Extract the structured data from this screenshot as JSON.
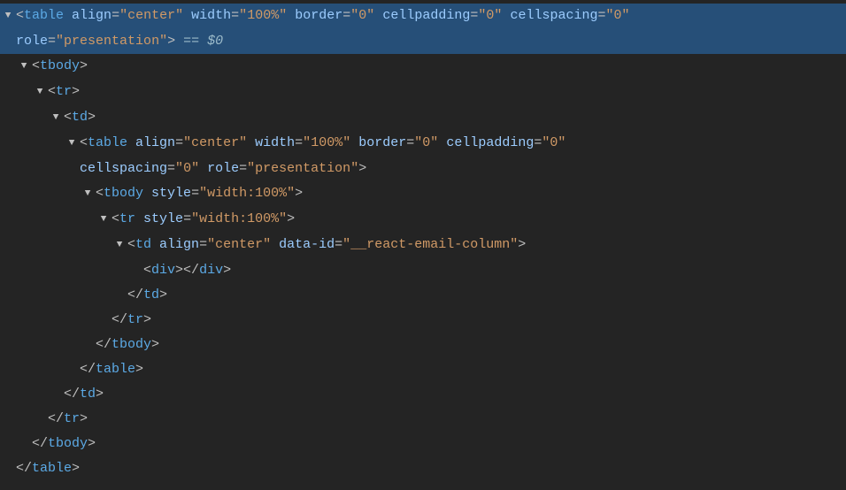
{
  "root": {
    "tag": "table",
    "attrs": [
      {
        "name": "align",
        "value": "center"
      },
      {
        "name": "width",
        "value": "100%"
      },
      {
        "name": "border",
        "value": "0"
      },
      {
        "name": "cellpadding",
        "value": "0"
      },
      {
        "name": "cellspacing",
        "value": "0"
      },
      {
        "name": "role",
        "value": "presentation"
      }
    ],
    "selected_suffix": "== $0"
  },
  "inner_table": {
    "tag": "table",
    "attrs": [
      {
        "name": "align",
        "value": "center"
      },
      {
        "name": "width",
        "value": "100%"
      },
      {
        "name": "border",
        "value": "0"
      },
      {
        "name": "cellpadding",
        "value": "0"
      },
      {
        "name": "cellspacing",
        "value": "0"
      },
      {
        "name": "role",
        "value": "presentation"
      }
    ]
  },
  "tbody2_attrs": [
    {
      "name": "style",
      "value": "width:100%"
    }
  ],
  "tr2_attrs": [
    {
      "name": "style",
      "value": "width:100%"
    }
  ],
  "td2_attrs": [
    {
      "name": "align",
      "value": "center"
    },
    {
      "name": "data-id",
      "value": "__react-email-column"
    }
  ],
  "tags": {
    "tbody": "tbody",
    "tr": "tr",
    "td": "td",
    "div": "div",
    "table": "table"
  },
  "suffix": {
    "label": "== $0"
  }
}
